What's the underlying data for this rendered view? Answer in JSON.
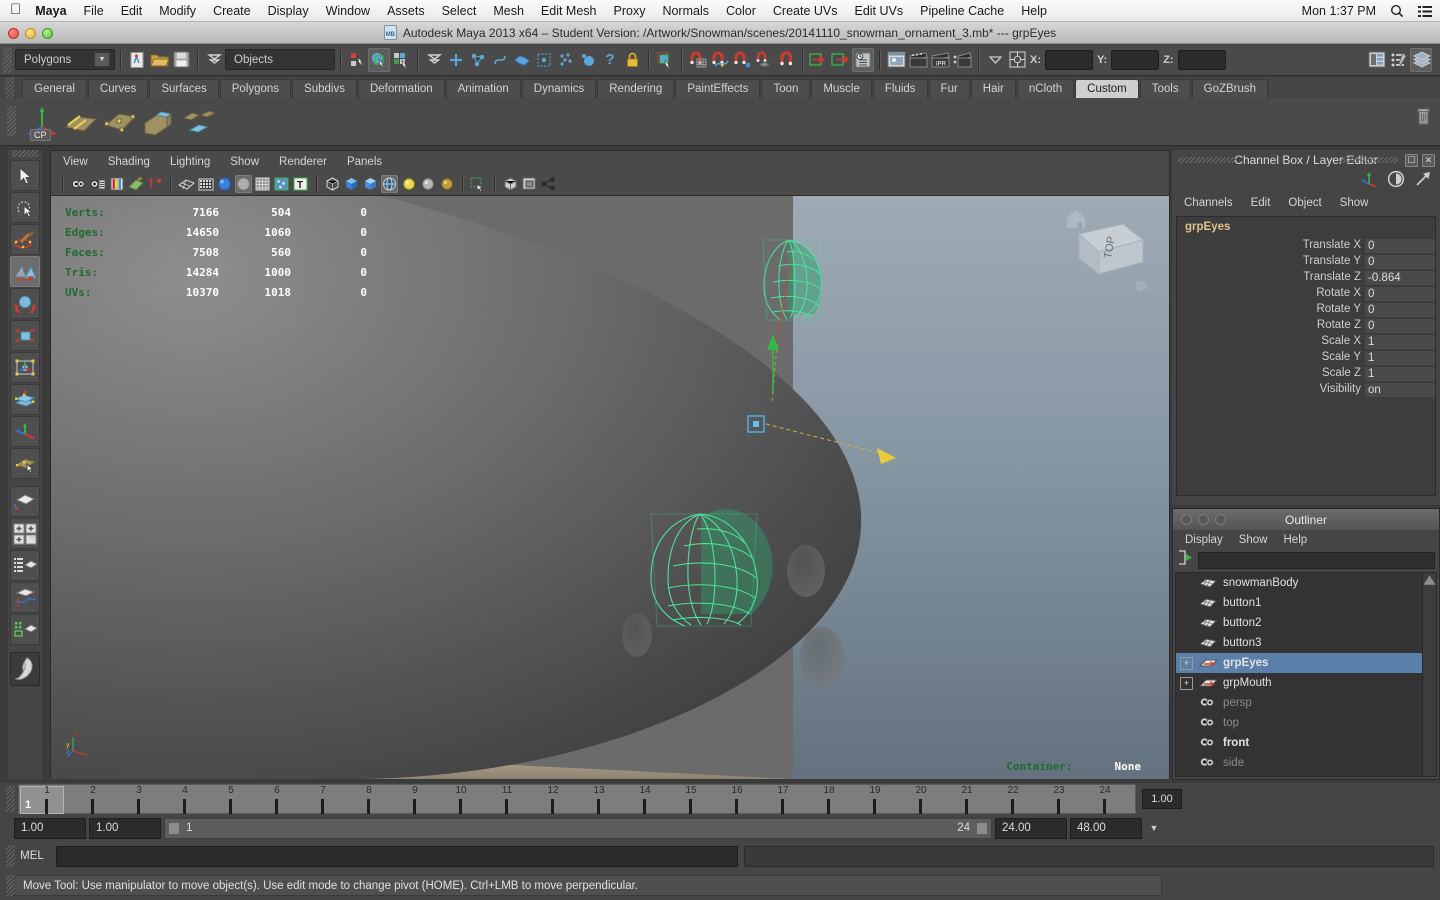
{
  "osx": {
    "apple_icon": "apple-icon",
    "menus": [
      "Maya",
      "File",
      "Edit",
      "Modify",
      "Create",
      "Display",
      "Window",
      "Assets",
      "Select",
      "Mesh",
      "Edit Mesh",
      "Proxy",
      "Normals",
      "Color",
      "Create UVs",
      "Edit UVs",
      "Pipeline Cache",
      "Help"
    ],
    "clock": "Mon 1:37 PM",
    "search_icon": "search-icon",
    "list_icon": "list-icon"
  },
  "titlebar": {
    "title": "Autodesk Maya 2013 x64 – Student Version: /Artwork/Snowman/scenes/20141110_snowman_ornament_3.mb*  ---  grpEyes",
    "doc_badge": "MB"
  },
  "statusline": {
    "mode_selector": "Polygons",
    "selection_mask_field": "Objects",
    "coord_labels": {
      "x": "X:",
      "y": "Y:",
      "z": "Z:"
    },
    "coord_values": {
      "x": "",
      "y": "",
      "z": ""
    }
  },
  "shelf": {
    "tabs": [
      "General",
      "Curves",
      "Surfaces",
      "Polygons",
      "Subdivs",
      "Deformation",
      "Animation",
      "Dynamics",
      "Rendering",
      "PaintEffects",
      "Toon",
      "Muscle",
      "Fluids",
      "Fur",
      "Hair",
      "nCloth",
      "Custom",
      "Tools",
      "GoZBrush"
    ],
    "active_tab": "Custom",
    "items": [
      {
        "name": "cp-axis-icon",
        "label": "CP"
      },
      {
        "name": "crease-tool-icon",
        "label": ""
      },
      {
        "name": "multi-cut-icon",
        "label": ""
      },
      {
        "name": "bevel-icon",
        "label": ""
      },
      {
        "name": "detach-icon",
        "label": ""
      }
    ],
    "trash_icon": "trash-icon"
  },
  "toolbox": {
    "items": [
      {
        "name": "select-tool",
        "selected": false
      },
      {
        "name": "lasso-tool",
        "selected": false
      },
      {
        "name": "paint-select-tool",
        "selected": false
      },
      {
        "name": "move-tool",
        "selected": true
      },
      {
        "name": "rotate-tool",
        "selected": false
      },
      {
        "name": "scale-tool",
        "selected": false
      },
      {
        "name": "universal-manipulator-tool",
        "selected": false
      },
      {
        "name": "soft-modification-tool",
        "selected": false
      },
      {
        "name": "show-manipulator-tool",
        "selected": false
      },
      {
        "name": "last-tool-used",
        "selected": false
      },
      {
        "name": "single-perspective-layout",
        "selected": false
      },
      {
        "name": "four-view-layout",
        "selected": false
      },
      {
        "name": "outliner-persp-layout",
        "selected": false
      },
      {
        "name": "persp-graph-layout",
        "selected": false
      },
      {
        "name": "hypershade-persp-layout",
        "selected": false
      },
      {
        "name": "paint-effects-logo",
        "selected": false
      }
    ]
  },
  "viewport": {
    "menus": [
      "View",
      "Shading",
      "Lighting",
      "Show",
      "Renderer",
      "Panels"
    ],
    "hud_headers": [],
    "hud_rows": [
      {
        "label": "Verts:",
        "total": "7166",
        "selected": "504",
        "third": "0"
      },
      {
        "label": "Edges:",
        "total": "14650",
        "selected": "1060",
        "third": "0"
      },
      {
        "label": "Faces:",
        "total": "7508",
        "selected": "560",
        "third": "0"
      },
      {
        "label": "Tris:",
        "total": "14284",
        "selected": "1000",
        "third": "0"
      },
      {
        "label": "UVs:",
        "total": "10370",
        "selected": "1018",
        "third": "0"
      }
    ],
    "container_label": "Container:",
    "container_value": "None",
    "view_cube_label": "TOP",
    "axis_labels": {
      "x": "x",
      "y": "y",
      "z": "z"
    }
  },
  "channelbox": {
    "title": "Channel Box / Layer Editor",
    "menus": [
      "Channels",
      "Edit",
      "Object",
      "Show"
    ],
    "object_name": "grpEyes",
    "attributes": [
      {
        "name": "Translate X",
        "value": "0"
      },
      {
        "name": "Translate Y",
        "value": "0"
      },
      {
        "name": "Translate Z",
        "value": "-0.864"
      },
      {
        "name": "Rotate X",
        "value": "0"
      },
      {
        "name": "Rotate Y",
        "value": "0"
      },
      {
        "name": "Rotate Z",
        "value": "0"
      },
      {
        "name": "Scale X",
        "value": "1"
      },
      {
        "name": "Scale Y",
        "value": "1"
      },
      {
        "name": "Scale Z",
        "value": "1"
      },
      {
        "name": "Visibility",
        "value": "on"
      }
    ],
    "header_icons": [
      "axis-icon",
      "clock-icon",
      "arrow-icon"
    ],
    "window_buttons": [
      "restore-icon",
      "close-icon"
    ]
  },
  "outliner": {
    "title": "Outliner",
    "menus": [
      "Display",
      "Show",
      "Help"
    ],
    "search_value": "",
    "items": [
      {
        "label": "snowmanBody",
        "icon": "mesh-icon",
        "expandable": false,
        "selected": false,
        "dim": false,
        "bold": false
      },
      {
        "label": "button1",
        "icon": "mesh-icon",
        "expandable": false,
        "selected": false,
        "dim": false,
        "bold": false
      },
      {
        "label": "button2",
        "icon": "mesh-icon",
        "expandable": false,
        "selected": false,
        "dim": false,
        "bold": false
      },
      {
        "label": "button3",
        "icon": "mesh-icon",
        "expandable": false,
        "selected": false,
        "dim": false,
        "bold": false
      },
      {
        "label": "grpEyes",
        "icon": "group-icon",
        "expandable": true,
        "selected": true,
        "dim": false,
        "bold": true
      },
      {
        "label": "grpMouth",
        "icon": "group-icon",
        "expandable": true,
        "selected": false,
        "dim": false,
        "bold": false
      },
      {
        "label": "persp",
        "icon": "camera-icon",
        "expandable": false,
        "selected": false,
        "dim": true,
        "bold": false
      },
      {
        "label": "top",
        "icon": "camera-icon",
        "expandable": false,
        "selected": false,
        "dim": true,
        "bold": false
      },
      {
        "label": "front",
        "icon": "camera-icon",
        "expandable": false,
        "selected": false,
        "dim": false,
        "bold": true
      },
      {
        "label": "side",
        "icon": "camera-icon",
        "expandable": false,
        "selected": false,
        "dim": true,
        "bold": false
      }
    ]
  },
  "timeslider": {
    "frames": [
      "1",
      "2",
      "3",
      "4",
      "5",
      "6",
      "7",
      "8",
      "9",
      "10",
      "11",
      "12",
      "13",
      "14",
      "15",
      "16",
      "17",
      "18",
      "19",
      "20",
      "21",
      "22",
      "23",
      "24"
    ],
    "current_frame": "1",
    "playback_speed": "1.00"
  },
  "rangeslider": {
    "anim_start": "1.00",
    "range_start": "1.00",
    "bar_start": "1",
    "bar_end": "24",
    "range_end": "24.00",
    "anim_end": "48.00",
    "dropdown_icon": "chevron-down-icon"
  },
  "commandline": {
    "language_label": "MEL",
    "input_value": "",
    "output_value": ""
  },
  "helpline": {
    "message": "Move Tool: Use manipulator to move object(s). Use edit mode to change pivot (HOME).  Ctrl+LMB to move perpendicular."
  },
  "colors": {
    "panel_bg": "#454545",
    "toolbar_bg": "#4a4a4a",
    "selection_blue": "#5a7fa8",
    "hud_green": "#1f6b2e",
    "object_name_gold": "#e0c38a",
    "wireframe_green": "#4ee29a"
  }
}
